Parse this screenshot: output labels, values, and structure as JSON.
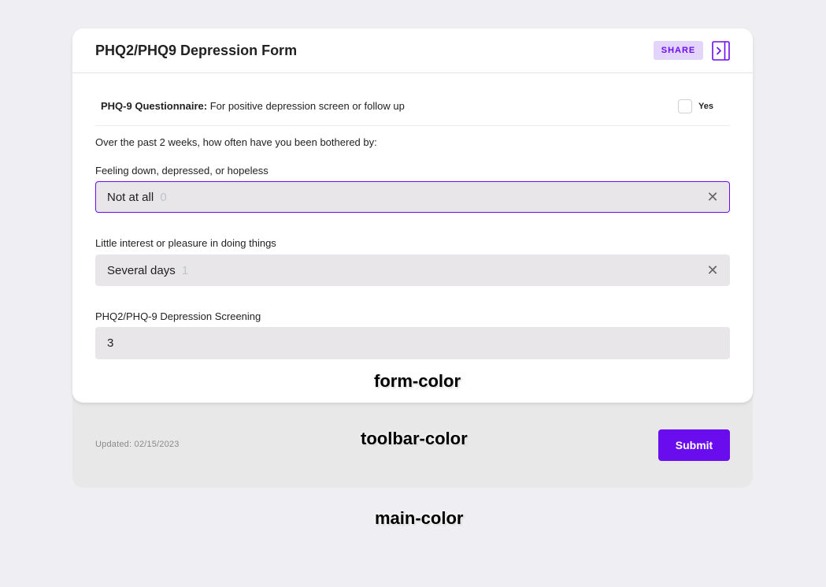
{
  "colors": {
    "accent": "#6a0dee",
    "share_bg": "#e3d4fb",
    "field_bg": "#e8e6e8",
    "toolbar_bg": "#e8e8e8",
    "main_bg": "#efeff3"
  },
  "form": {
    "title": "PHQ2/PHQ9 Depression Form",
    "share_label": "SHARE",
    "panel_icon": "sidebar-toggle-icon",
    "questionnaire": {
      "title": "PHQ-9 Questionnaire:",
      "description": "For positive depression screen or follow up",
      "checkbox_label": "Yes",
      "checked": false
    },
    "intro": "Over the past 2 weeks, how often have you been bothered by:",
    "fields": [
      {
        "label": "Feeling down, depressed, or hopeless",
        "value": "Not at all",
        "score": "0"
      },
      {
        "label": "Little interest or pleasure in doing things",
        "value": "Several days",
        "score": "1"
      }
    ],
    "screening": {
      "label": "PHQ2/PHQ-9 Depression Screening",
      "value": "3"
    }
  },
  "toolbar": {
    "updated": "Updated: 02/15/2023",
    "submit_label": "Submit"
  },
  "annotations": {
    "form": "form-color",
    "toolbar": "toolbar-color",
    "main": "main-color"
  }
}
